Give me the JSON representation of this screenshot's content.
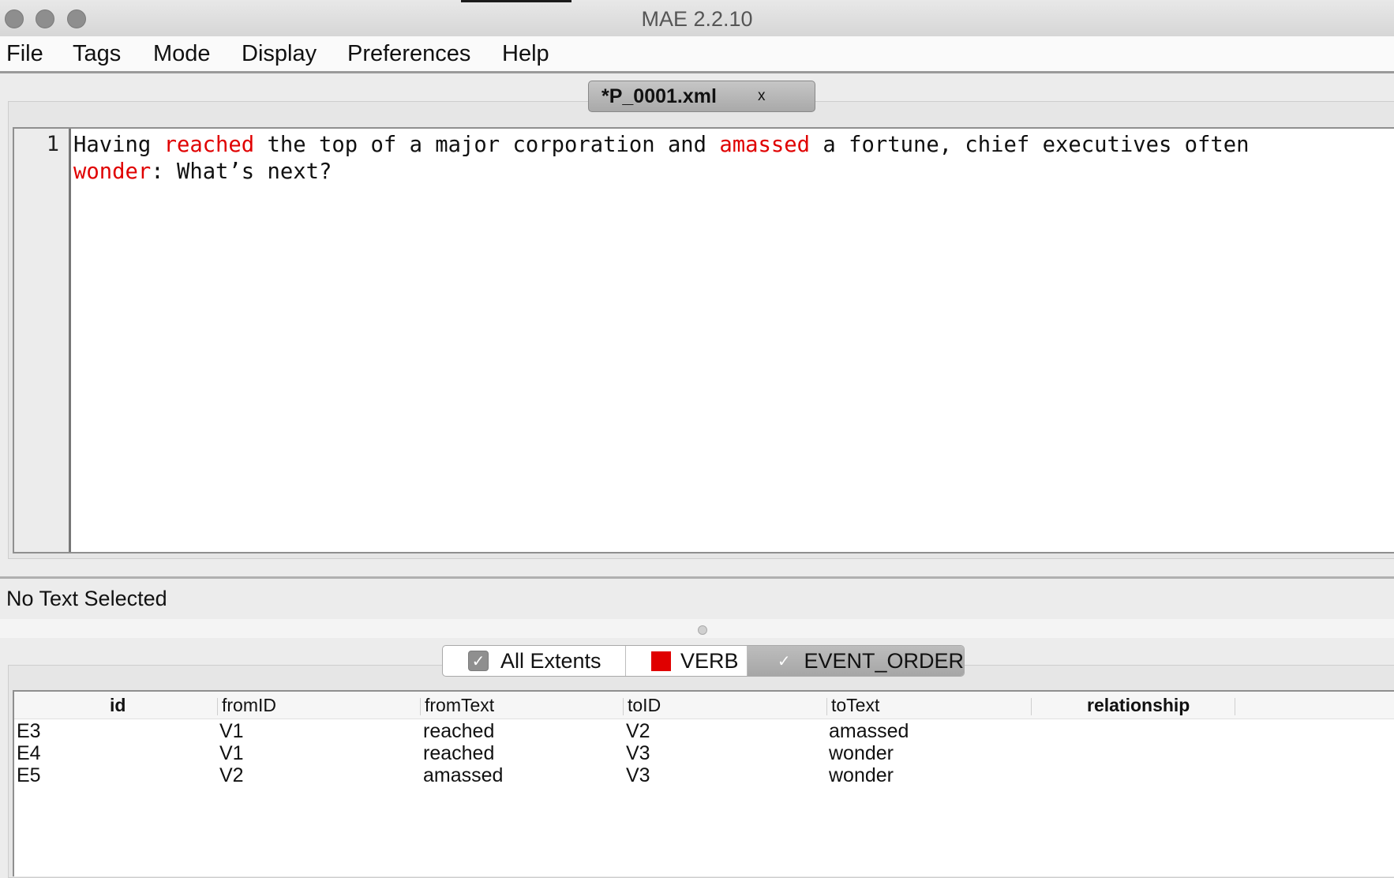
{
  "window": {
    "title": "MAE 2.2.10"
  },
  "menubar": {
    "items": [
      "File",
      "Tags",
      "Mode",
      "Display",
      "Preferences",
      "Help"
    ]
  },
  "document_tab": {
    "label": "*P_0001.xml",
    "close_glyph": "x"
  },
  "editor": {
    "line_number": "1",
    "text_segments": [
      {
        "text": "Having ",
        "tag": null
      },
      {
        "text": "reached",
        "tag": "VERB"
      },
      {
        "text": " the top of a major corporation and ",
        "tag": null
      },
      {
        "text": "amassed",
        "tag": "VERB"
      },
      {
        "text": " a fortune, chief executives often ",
        "tag": null
      },
      {
        "text": "wonder",
        "tag": "VERB"
      },
      {
        "text": ": What’s next?",
        "tag": null
      }
    ],
    "highlight_color": "#e00000"
  },
  "status": {
    "text": "No Text Selected"
  },
  "tag_tabs": {
    "all_extents": {
      "label": "All Extents",
      "checked": true
    },
    "verb": {
      "label": "VERB",
      "color": "#e00000"
    },
    "event_order": {
      "label": "EVENT_ORDER",
      "checked": true,
      "selected": true
    }
  },
  "table": {
    "columns": [
      "id",
      "fromID",
      "fromText",
      "toID",
      "toText",
      "relationship"
    ],
    "rows": [
      [
        "E3",
        "V1",
        "reached",
        "V2",
        "amassed",
        ""
      ],
      [
        "E4",
        "V1",
        "reached",
        "V3",
        "wonder",
        ""
      ],
      [
        "E5",
        "V2",
        "amassed",
        "V3",
        "wonder",
        ""
      ]
    ]
  }
}
